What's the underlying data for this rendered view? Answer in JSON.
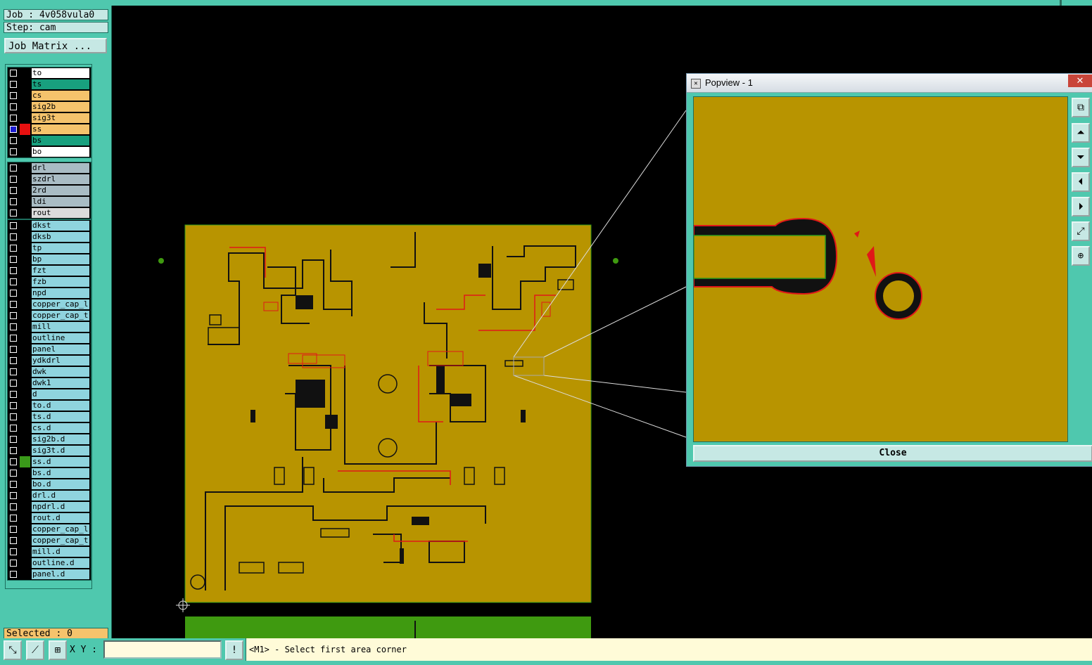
{
  "job": {
    "job_label": "Job : 4v058vula0",
    "step_label": "Step: cam",
    "matrix_button": "Job Matrix ..."
  },
  "layer_groups": [
    {
      "layers": [
        {
          "name": "to",
          "color": "#ffffff",
          "selected": false,
          "swatch": ""
        },
        {
          "name": "ts",
          "color": "#18a07e",
          "selected": false,
          "swatch": ""
        },
        {
          "name": "cs",
          "color": "#f5c36c",
          "selected": false,
          "swatch": ""
        },
        {
          "name": "sig2b",
          "color": "#f5c36c",
          "selected": false,
          "swatch": ""
        },
        {
          "name": "sig3t",
          "color": "#f5c36c",
          "selected": false,
          "swatch": ""
        },
        {
          "name": "ss",
          "color": "#f5c36c",
          "selected": true,
          "swatch": "#e81010"
        },
        {
          "name": "bs",
          "color": "#18a07e",
          "selected": false,
          "swatch": ""
        },
        {
          "name": "bo",
          "color": "#ffffff",
          "selected": false,
          "swatch": ""
        }
      ]
    },
    {
      "layers": [
        {
          "name": "drl",
          "color": "#a9bcc4",
          "selected": false,
          "swatch": ""
        },
        {
          "name": "szdrl",
          "color": "#a9bcc4",
          "selected": false,
          "swatch": ""
        },
        {
          "name": "2rd",
          "color": "#a9bcc4",
          "selected": false,
          "swatch": ""
        },
        {
          "name": "ldi",
          "color": "#a9bcc4",
          "selected": false,
          "swatch": ""
        },
        {
          "name": "rout",
          "color": "#dcdcdc",
          "selected": false,
          "swatch": ""
        }
      ]
    },
    {
      "layers": [
        {
          "name": "dkst",
          "color": "#8fd4de",
          "selected": false,
          "swatch": ""
        },
        {
          "name": "dksb",
          "color": "#8fd4de",
          "selected": false,
          "swatch": ""
        },
        {
          "name": "tp",
          "color": "#8fd4de",
          "selected": false,
          "swatch": ""
        },
        {
          "name": "bp",
          "color": "#8fd4de",
          "selected": false,
          "swatch": ""
        },
        {
          "name": "fzt",
          "color": "#8fd4de",
          "selected": false,
          "swatch": ""
        },
        {
          "name": "fzb",
          "color": "#8fd4de",
          "selected": false,
          "swatch": ""
        },
        {
          "name": "npd",
          "color": "#8fd4de",
          "selected": false,
          "swatch": ""
        },
        {
          "name": "copper_cap_l",
          "color": "#8fd4de",
          "selected": false,
          "swatch": ""
        },
        {
          "name": "copper_cap_t",
          "color": "#8fd4de",
          "selected": false,
          "swatch": ""
        },
        {
          "name": "mill",
          "color": "#8fd4de",
          "selected": false,
          "swatch": ""
        },
        {
          "name": "outline",
          "color": "#8fd4de",
          "selected": false,
          "swatch": ""
        },
        {
          "name": "panel",
          "color": "#8fd4de",
          "selected": false,
          "swatch": ""
        },
        {
          "name": "ydkdrl",
          "color": "#8fd4de",
          "selected": false,
          "swatch": ""
        },
        {
          "name": "dwk",
          "color": "#8fd4de",
          "selected": false,
          "swatch": ""
        },
        {
          "name": "dwk1",
          "color": "#8fd4de",
          "selected": false,
          "swatch": ""
        },
        {
          "name": "d",
          "color": "#8fd4de",
          "selected": false,
          "swatch": ""
        },
        {
          "name": "to.d",
          "color": "#8fd4de",
          "selected": false,
          "swatch": ""
        },
        {
          "name": "ts.d",
          "color": "#8fd4de",
          "selected": false,
          "swatch": ""
        },
        {
          "name": "cs.d",
          "color": "#8fd4de",
          "selected": false,
          "swatch": ""
        },
        {
          "name": "sig2b.d",
          "color": "#8fd4de",
          "selected": false,
          "swatch": ""
        },
        {
          "name": "sig3t.d",
          "color": "#8fd4de",
          "selected": false,
          "swatch": ""
        },
        {
          "name": "ss.d",
          "color": "#8fd4de",
          "selected": false,
          "swatch": "#3a9a1a"
        },
        {
          "name": "bs.d",
          "color": "#8fd4de",
          "selected": false,
          "swatch": ""
        },
        {
          "name": "bo.d",
          "color": "#8fd4de",
          "selected": false,
          "swatch": ""
        },
        {
          "name": "drl.d",
          "color": "#8fd4de",
          "selected": false,
          "swatch": ""
        },
        {
          "name": "npdrl.d",
          "color": "#8fd4de",
          "selected": false,
          "swatch": ""
        },
        {
          "name": "rout.d",
          "color": "#8fd4de",
          "selected": false,
          "swatch": ""
        },
        {
          "name": "copper_cap_l",
          "color": "#8fd4de",
          "selected": false,
          "swatch": ""
        },
        {
          "name": "copper_cap_t",
          "color": "#8fd4de",
          "selected": false,
          "swatch": ""
        },
        {
          "name": "mill.d",
          "color": "#8fd4de",
          "selected": false,
          "swatch": ""
        },
        {
          "name": "outline.d",
          "color": "#8fd4de",
          "selected": false,
          "swatch": ""
        },
        {
          "name": "panel.d",
          "color": "#8fd4de",
          "selected": false,
          "swatch": ""
        }
      ]
    }
  ],
  "status": {
    "selected": "Selected : 0"
  },
  "bottom": {
    "xy_label": "X Y :",
    "xy_value": "",
    "alert_icon": "!",
    "prompt": "<M1> - Select first area corner"
  },
  "popview": {
    "title": "Popview - 1",
    "close_x": "✕",
    "close_button": "Close"
  },
  "colors": {
    "board": "#b89400",
    "trace_red": "#e01818",
    "trace_green": "#2f9a1a",
    "panel_green": "#3f9a10",
    "ui_teal": "#4fc8ae"
  }
}
